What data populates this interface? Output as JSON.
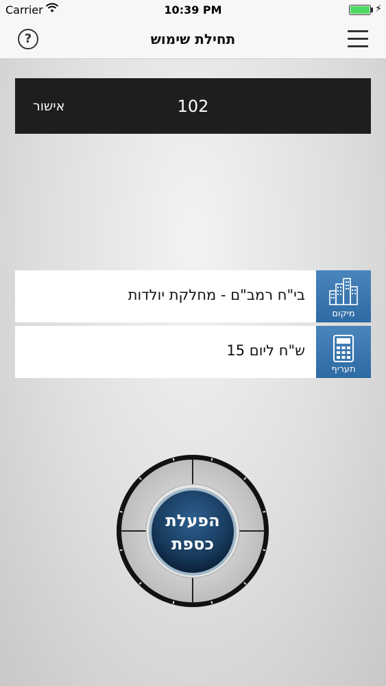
{
  "status_bar": {
    "carrier": "Carrier",
    "time": "10:39 PM",
    "battery_level": 1.0
  },
  "nav": {
    "title": "תחילת שימוש",
    "help_label": "?"
  },
  "code_panel": {
    "code": "102",
    "confirm_label": "אישור"
  },
  "location": {
    "text": "בי\"ח רמב\"ם - מחלקת יולדות",
    "tile_label": "מיקום",
    "icon": "buildings-icon"
  },
  "tariff": {
    "text": "ש\"ח ליום 15",
    "tile_label": "תעריף",
    "icon": "calculator-icon"
  },
  "activate_button": {
    "line1": "הפעלת",
    "line2": "כספת"
  },
  "colors": {
    "tile_blue": "#3a78b0",
    "panel_dark": "#1e1e1e",
    "button_navy": "#1a3f63",
    "battery_green": "#4cd964"
  }
}
